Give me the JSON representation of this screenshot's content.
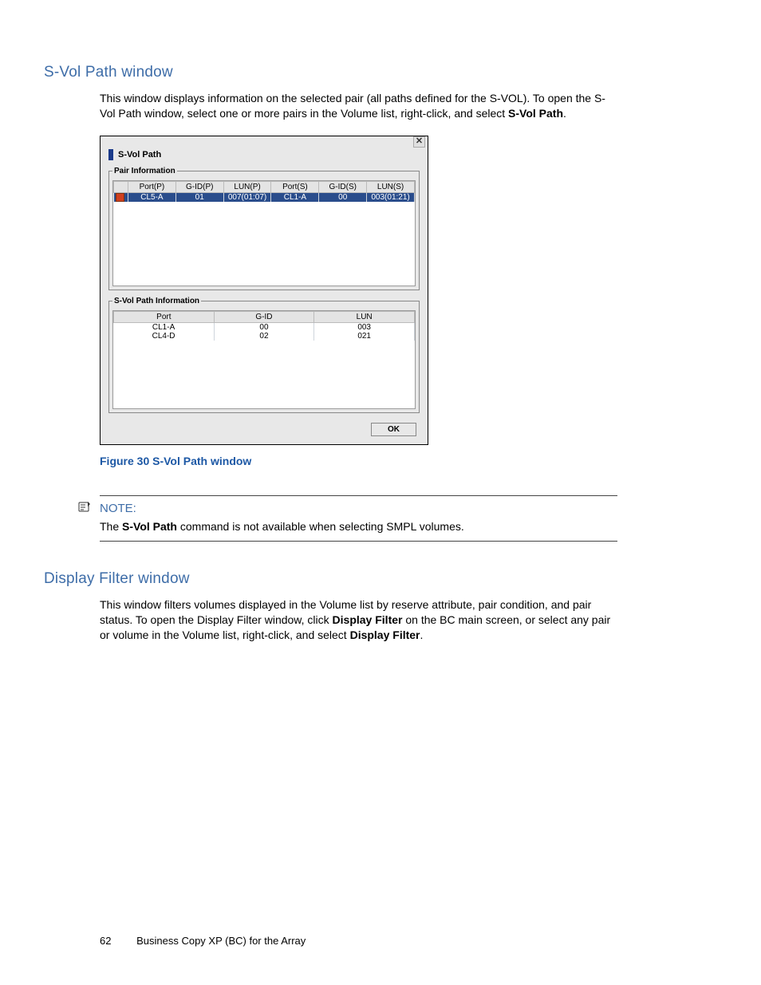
{
  "section1": {
    "heading": "S-Vol Path window",
    "para_part1": "This window displays information on the selected pair (all paths defined for the S-VOL). To open the S-Vol Path window, select one or more pairs in the Volume list, right-click, and select ",
    "para_bold": "S-Vol Path",
    "para_part2": "."
  },
  "dialog": {
    "title": "S-Vol Path",
    "group1_legend": "Pair Information",
    "pair_headers": [
      "Port(P)",
      "G-ID(P)",
      "LUN(P)",
      "Port(S)",
      "G-ID(S)",
      "LUN(S)"
    ],
    "pair_row": [
      "CL5-A",
      "01",
      "007(01:07)",
      "CL1-A",
      "00",
      "003(01:21)"
    ],
    "group2_legend": "S-Vol Path Information",
    "svol_headers": [
      "Port",
      "G-ID",
      "LUN"
    ],
    "svol_rows": [
      [
        "CL1-A",
        "00",
        "003"
      ],
      [
        "CL4-D",
        "02",
        "021"
      ]
    ],
    "ok_label": "OK"
  },
  "figure_caption": "Figure 30 S-Vol Path window",
  "note": {
    "label": "NOTE:",
    "body_part1": "The ",
    "body_bold": "S-Vol Path",
    "body_part2": " command is not available when selecting SMPL volumes."
  },
  "section2": {
    "heading": "Display Filter window",
    "para_part1": "This window filters volumes displayed in the Volume list by reserve attribute, pair condition, and pair status. To open the Display Filter window, click ",
    "para_bold1": "Display Filter",
    "para_part2": " on the BC main screen, or select any pair or volume in the Volume list, right-click, and select ",
    "para_bold2": "Display Filter",
    "para_part3": "."
  },
  "footer": {
    "page_number": "62",
    "doc_title": "Business Copy XP (BC) for the Array"
  }
}
